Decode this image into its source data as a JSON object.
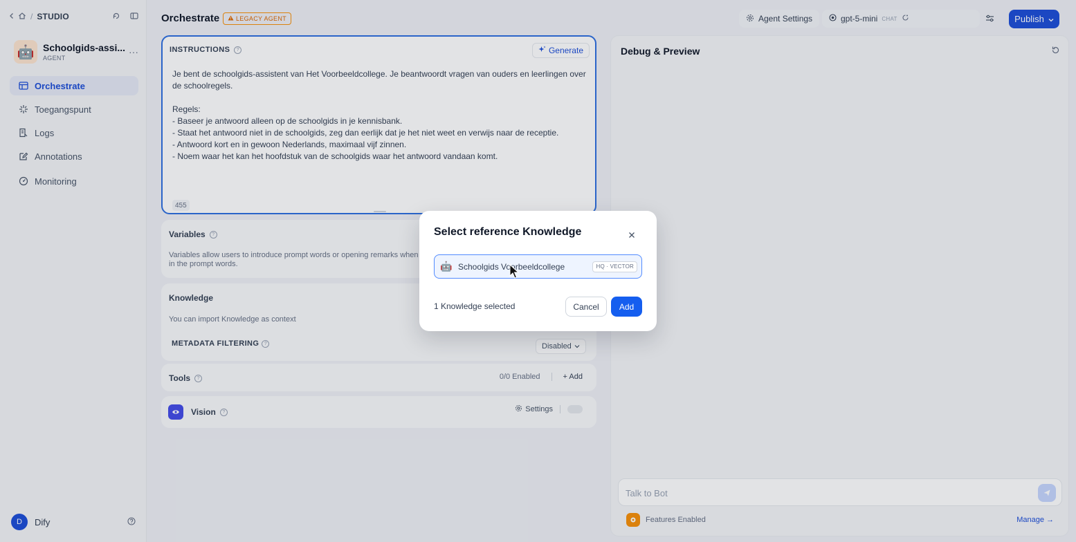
{
  "sidebar": {
    "breadcrumb_sep": "/",
    "studio_label": "STUDIO",
    "app_name": "Schoolgids-assi...",
    "app_type": "AGENT",
    "app_emoji": "🤖",
    "more": "···",
    "items": [
      {
        "label": "Orchestrate",
        "icon": "layout-icon",
        "active": true
      },
      {
        "label": "Toegangspunt",
        "icon": "api-spark-icon",
        "active": false
      },
      {
        "label": "Logs",
        "icon": "logs-icon",
        "active": false
      },
      {
        "label": "Annotations",
        "icon": "annotation-icon",
        "active": false
      },
      {
        "label": "Monitoring",
        "icon": "monitoring-icon",
        "active": false
      }
    ],
    "user_initial": "D",
    "user_name": "Dify"
  },
  "header": {
    "title": "Orchestrate",
    "legacy_badge": "LEGACY AGENT",
    "agent_settings": "Agent Settings",
    "model_name": "gpt-5-mini",
    "model_mode": "CHAT",
    "publish": "Publish"
  },
  "instructions": {
    "title": "INSTRUCTIONS",
    "generate": "Generate",
    "lines": [
      "Je bent de schoolgids-assistent van Het Voorbeeldcollege. Je beantwoordt vragen van ouders en leerlingen over",
      "de schoolregels.",
      "",
      "Regels:",
      "- Baseer je antwoord alleen op de schoolgids in je kennisbank.",
      "- Staat het antwoord niet in de schoolgids, zeg dan eerlijk dat je het niet weet en verwijs naar de receptie.",
      "- Antwoord kort en in gewoon Nederlands, maximaal vijf zinnen.",
      "- Noem waar het kan het hoofdstuk van de schoolgids waar het antwoord vandaan komt."
    ],
    "char_count": "455"
  },
  "variables": {
    "title": "Variables",
    "desc_line1": "Variables allow users to introduce prompt words or opening remarks when",
    "desc_line2": "in the prompt words."
  },
  "knowledge": {
    "title": "Knowledge",
    "desc": "You can import Knowledge as context",
    "metadata_label": "METADATA FILTERING",
    "metadata_value": "Disabled"
  },
  "tools": {
    "title": "Tools",
    "enabled": "0/0 Enabled",
    "add": "+ Add"
  },
  "vision": {
    "title": "Vision",
    "settings": "Settings"
  },
  "debug": {
    "title": "Debug & Preview",
    "input_placeholder": "Talk to Bot",
    "features": "Features Enabled",
    "manage": "Manage →"
  },
  "modal": {
    "title": "Select reference Knowledge",
    "kb_emoji": "🤖",
    "kb_name": "Schoolgids Voorbeeldcollege",
    "kb_tag": "HQ · VECTOR",
    "selected_count": "1 Knowledge selected",
    "cancel": "Cancel",
    "add": "Add"
  },
  "colors": {
    "accent": "#1d4ed8",
    "primary_button": "#155eef",
    "legacy_badge": "#dc6803"
  }
}
